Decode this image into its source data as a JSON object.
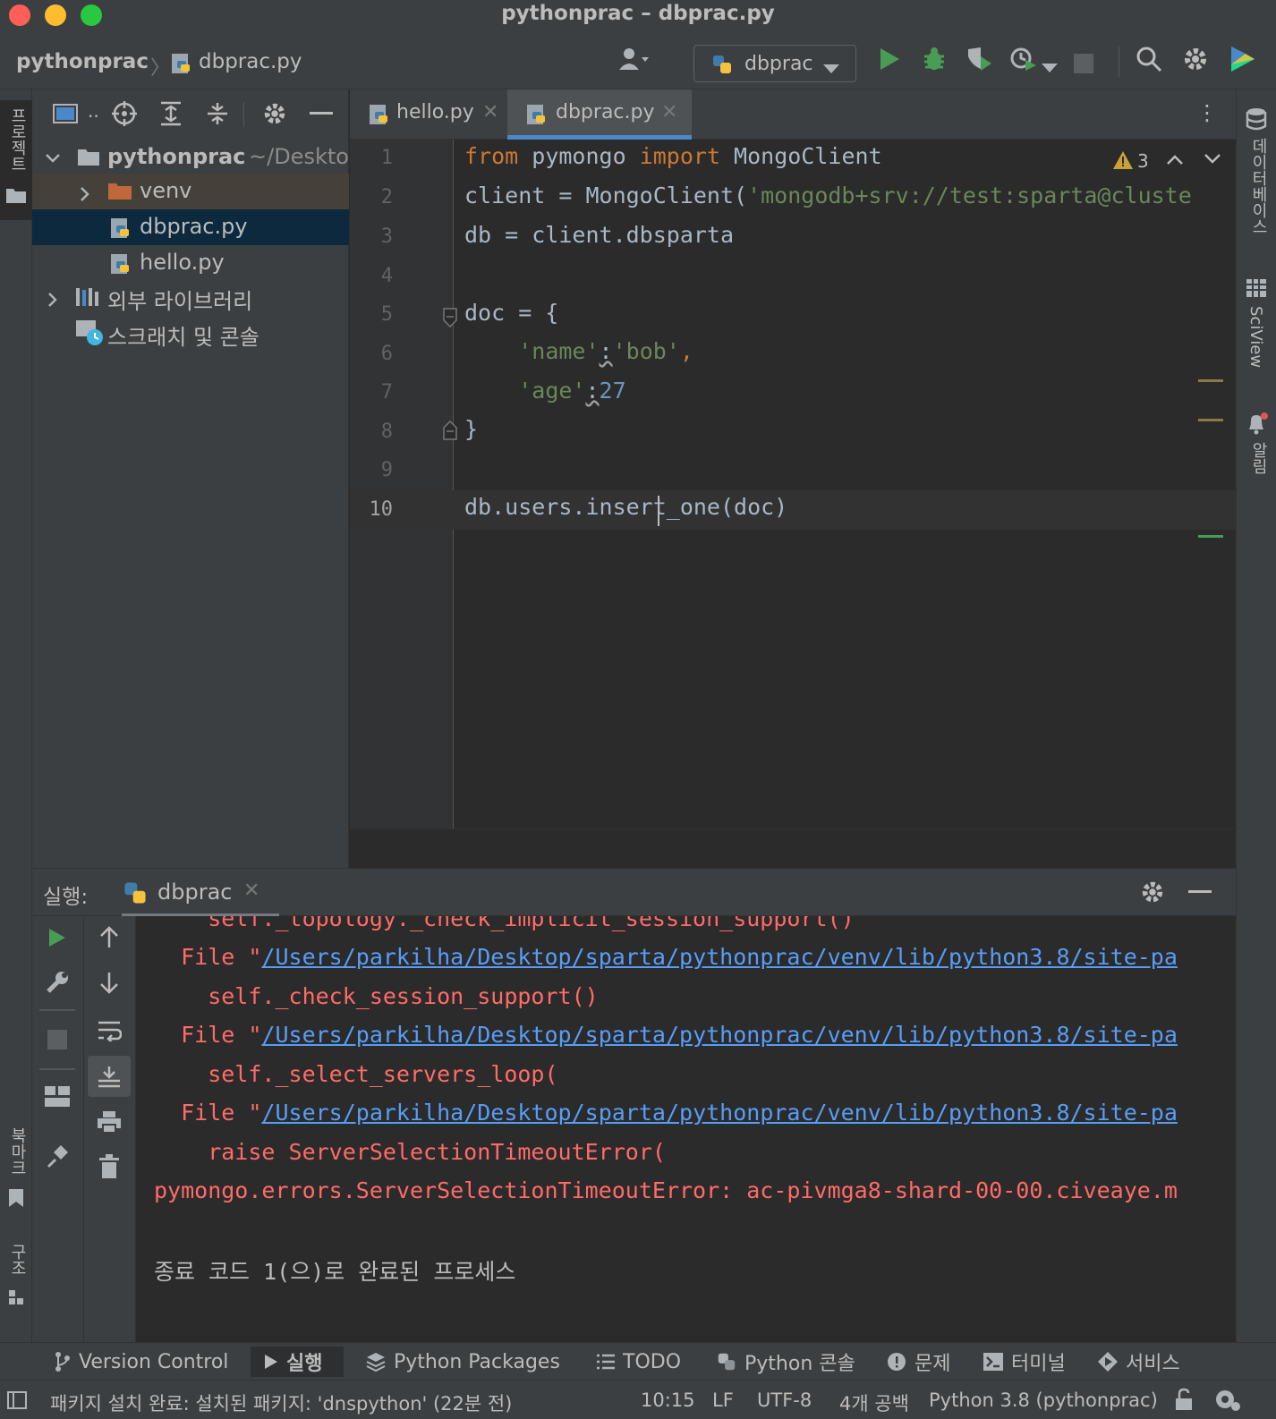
{
  "window": {
    "title": "pythonprac – dbprac.py"
  },
  "toolbar": {
    "breadcrumb_project": "pythonprac",
    "breadcrumb_file": "dbprac.py",
    "run_config": "dbprac"
  },
  "left_strip": {
    "project_label": "프로젝트",
    "bookmarks_label": "북마크",
    "structure_label": "구조"
  },
  "right_strip": {
    "database_label": "데이터베이스",
    "sciview_label": "SciView",
    "notifications_label": "알림"
  },
  "project_tree": {
    "root_name": "pythonprac",
    "root_path": "~/Deskto",
    "items": [
      {
        "label": "venv"
      },
      {
        "label": "dbprac.py"
      },
      {
        "label": "hello.py"
      },
      {
        "label": "외부 라이브러리"
      },
      {
        "label": "스크래치 및 콘솔"
      }
    ]
  },
  "editor_tabs": [
    {
      "label": "hello.py",
      "active": false
    },
    {
      "label": "dbprac.py",
      "active": true
    }
  ],
  "editor": {
    "warning_count": "3",
    "line_numbers": [
      "1",
      "2",
      "3",
      "4",
      "5",
      "6",
      "7",
      "8",
      "9",
      "10"
    ],
    "lines": {
      "l1_kw1": "from",
      "l1_mid": " pymongo ",
      "l1_kw2": "import",
      "l1_end": " MongoClient",
      "l2_a": "client = MongoClient(",
      "l2_str": "'mongodb+srv://test:sparta@cluste",
      "l3": "db = client.dbsparta",
      "l5": "doc = {",
      "l6_indent": "    ",
      "l6_s1": "'name'",
      "l6_colon": ":",
      "l6_s2": "'bob'",
      "l6_comma": ",",
      "l7_indent": "    ",
      "l7_s1": "'age'",
      "l7_colon": ":",
      "l7_num": "27",
      "l8": "}",
      "l10": "db.users.insert_one(doc)"
    }
  },
  "run_panel": {
    "label": "실행:",
    "tab": "dbprac",
    "console": {
      "line1": "    self._topology._check_implicit_session_support()",
      "file_prefix": "  File \"",
      "file_path": "/Users/parkilha/Desktop/sparta/pythonprac/venv/lib/python3.8/site-pa",
      "line3": "    self._check_session_support()",
      "line5": "    self._select_servers_loop(",
      "line7": "    raise ServerSelectionTimeoutError(",
      "line8": "pymongo.errors.ServerSelectionTimeoutError: ac-pivmga8-shard-00-00.civeaye.m",
      "exit_line": "종료 코드 1(으)로 완료된 프로세스"
    }
  },
  "bottom_tabs": [
    {
      "label": "Version Control"
    },
    {
      "label": "실행"
    },
    {
      "label": "Python Packages"
    },
    {
      "label": "TODO"
    },
    {
      "label": "Python 콘솔"
    },
    {
      "label": "문제"
    },
    {
      "label": "터미널"
    },
    {
      "label": "서비스"
    }
  ],
  "status": {
    "message": "패키지 설치 완료: 설치된 패키지: 'dnspython' (22분 전)",
    "position": "10:15",
    "line_sep": "LF",
    "encoding": "UTF-8",
    "indent": "4개 공백",
    "interpreter": "Python 3.8 (pythonprac)"
  },
  "colors": {
    "accent": "#4a88c7",
    "run_green": "#499c54",
    "error_red": "#ff6b68",
    "link_blue": "#589df6"
  }
}
